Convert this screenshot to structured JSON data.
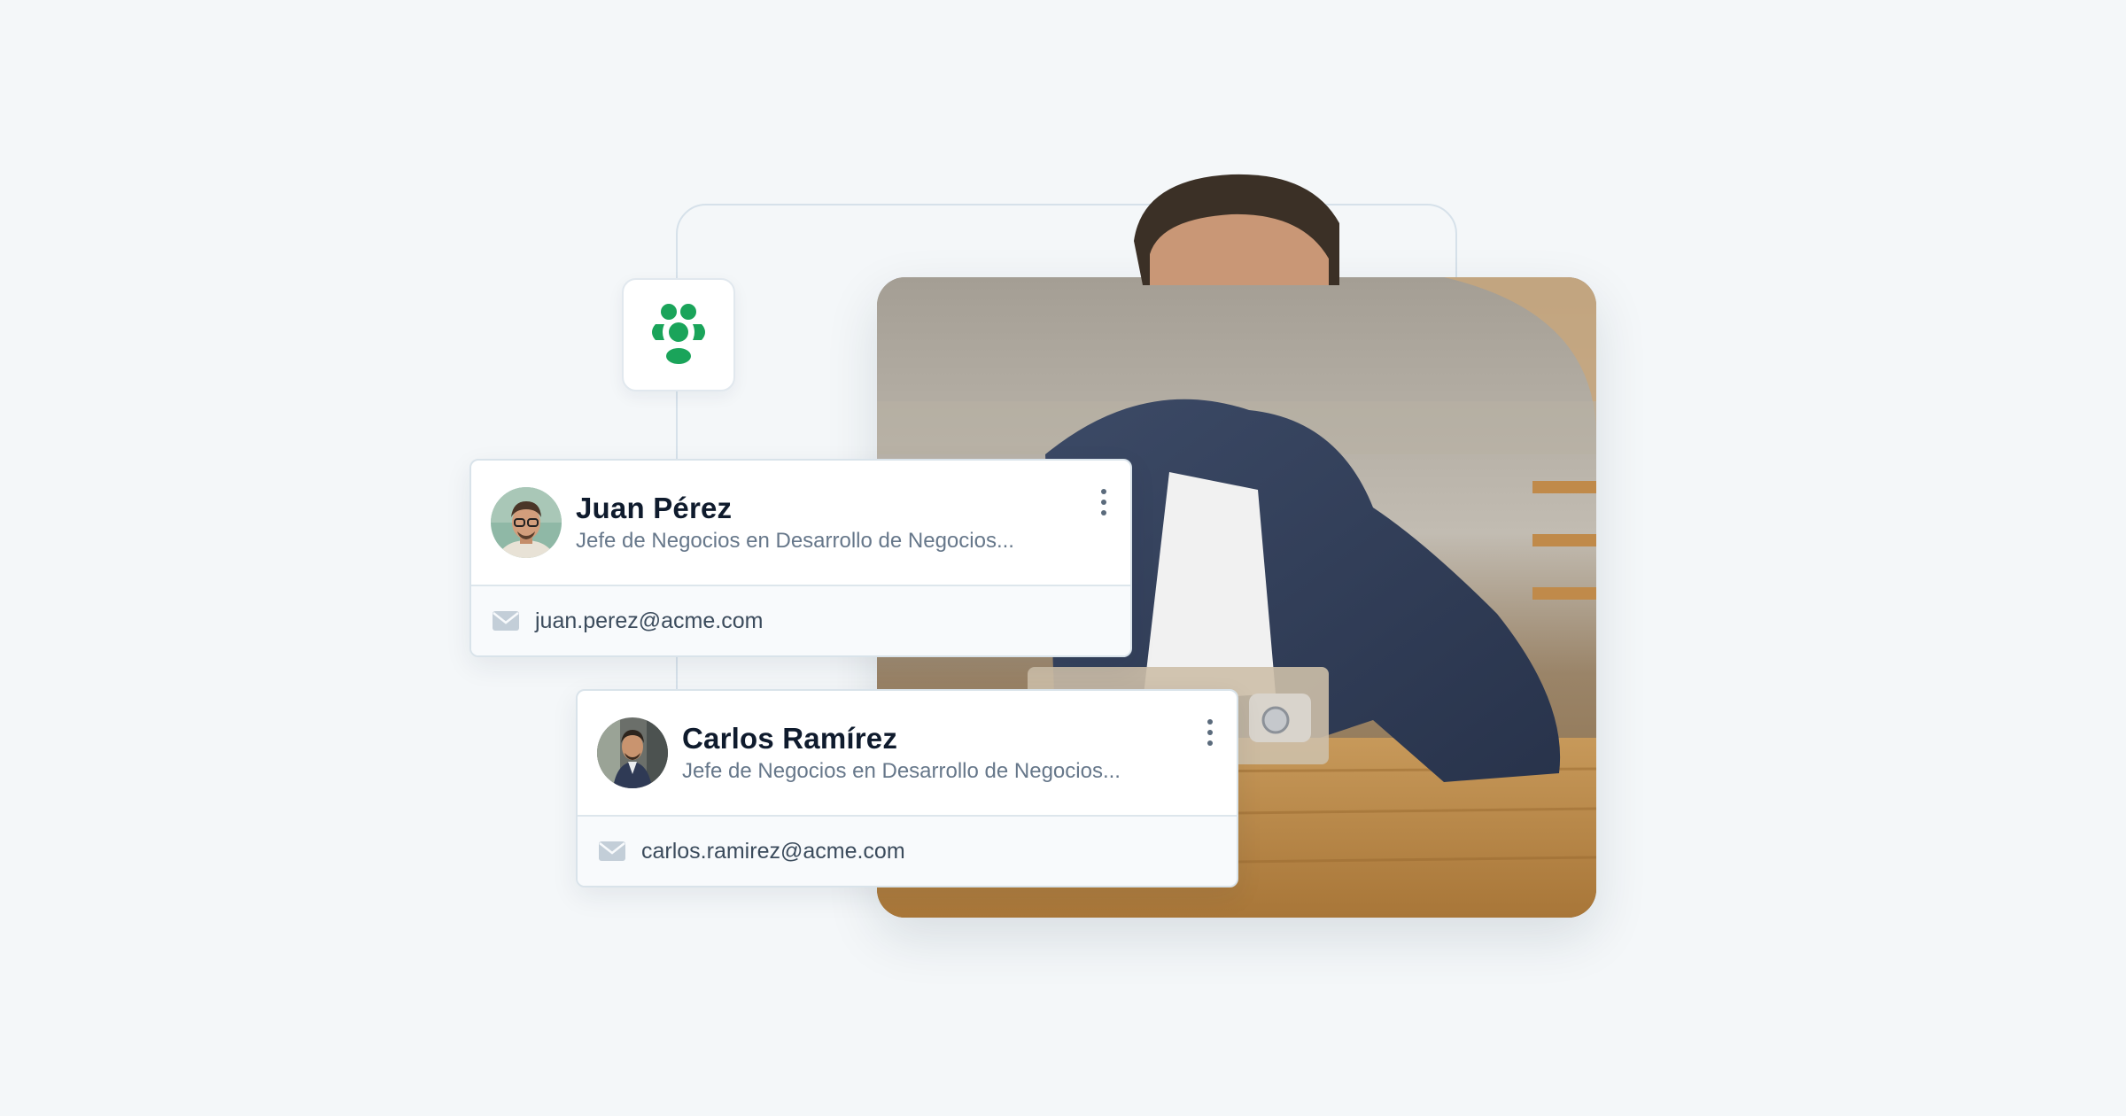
{
  "brand": {
    "logo_icon": "team-icon",
    "accent_color": "#1aa45a"
  },
  "hero": {
    "photo_subject": "man-using-laptop-photo"
  },
  "contacts": [
    {
      "name": "Juan Pérez",
      "role": "Jefe de Negocios en Desarrollo de Negocios...",
      "email": "juan.perez@acme.com",
      "avatar_icon": "avatar-photo",
      "menu_icon": "more-vertical-icon",
      "email_icon": "mail-icon"
    },
    {
      "name": "Carlos Ramírez",
      "role": "Jefe de Negocios en Desarrollo de Negocios...",
      "email": "carlos.ramirez@acme.com",
      "avatar_icon": "avatar-photo",
      "menu_icon": "more-vertical-icon",
      "email_icon": "mail-icon"
    }
  ],
  "colors": {
    "background": "#f4f7f9",
    "name_text": "#0f1b2d",
    "role_text": "#66778a",
    "connector": "#d6e1ea"
  }
}
